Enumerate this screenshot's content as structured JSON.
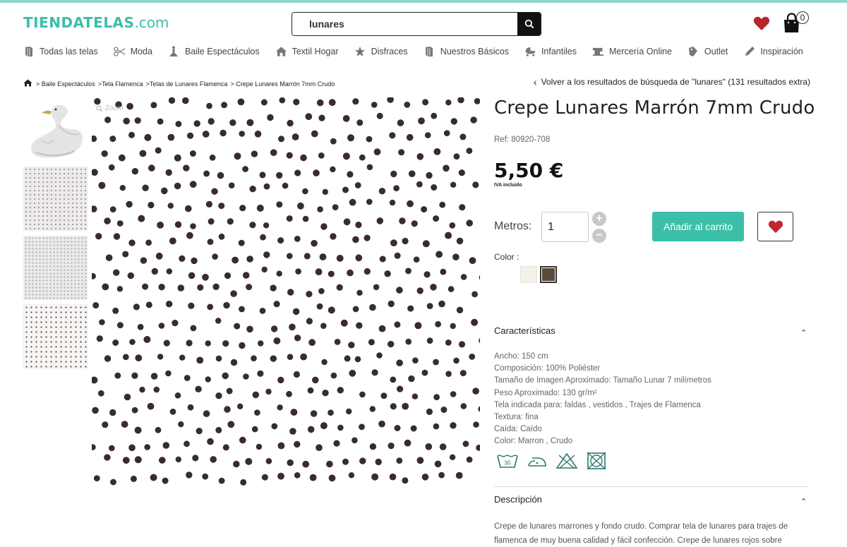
{
  "brand": {
    "logo_main": "TIENDATELAS",
    "logo_suffix": ".com",
    "accent": "#3cbfa8"
  },
  "search": {
    "value": "lunares",
    "button_icon": "search-icon"
  },
  "header": {
    "cart_count": "0",
    "wishlist_icon": "heart-icon",
    "cart_icon": "bag-icon"
  },
  "nav": [
    {
      "label": "Todas las telas",
      "icon": "fabric-roll-icon"
    },
    {
      "label": "Moda",
      "icon": "scissors-icon"
    },
    {
      "label": "Baile Espectáculos",
      "icon": "dancer-icon"
    },
    {
      "label": "Textil Hogar",
      "icon": "home-icon"
    },
    {
      "label": "Disfraces",
      "icon": "star-icon"
    },
    {
      "label": "Nuestros Básicos",
      "icon": "fabric-roll-icon"
    },
    {
      "label": "Infantiles",
      "icon": "baby-carriage-icon"
    },
    {
      "label": "Mercería Online",
      "icon": "sewing-machine-icon"
    },
    {
      "label": "Outlet",
      "icon": "tag-icon"
    },
    {
      "label": "Inspiración",
      "icon": "pencil-icon"
    }
  ],
  "breadcrumb": [
    "> Baile Espectáculos",
    ">Tela Flamenca",
    ">Telas de Lunares Flamenca",
    "> Crepe Lunares Marrón 7mm Crudo"
  ],
  "back_link": "Volver a los resultados de búsqueda de \"lunares\" (131 resultados extra)",
  "zoom_label": "Zoom",
  "product": {
    "title": "Crepe Lunares Marrón 7mm Crudo",
    "ref": "Ref: 80920-708",
    "price": "5,50 €",
    "iva": "IVA incluido",
    "metros_label": "Metros:",
    "quantity": "1",
    "plus": "+",
    "minus": "−",
    "add_to_cart": "Añadir al carrito",
    "color_label": "Color :",
    "colors": [
      "#f3f1ea",
      "#5a4a3a"
    ]
  },
  "caracteristicas": {
    "title": "Características",
    "rows": [
      "Ancho:  150 cm",
      "Composición:  100% Poliéster",
      "Tamaño de Imagen Aproximado:  Tamaño Lunar 7 milímetros",
      "Peso Aproximado:  130 gr/m²",
      "Tela indicada para:  faldas , vestidos , Trajes de Flamenca",
      "Textura:  fina",
      "Caída:  Caído",
      "Color:  Marron , Crudo"
    ],
    "care_icons": [
      "wash-30-icon",
      "iron-low-icon",
      "no-bleach-icon",
      "no-tumble-dry-icon"
    ],
    "wash_temp": "30"
  },
  "descripcion": {
    "title": "Descripción",
    "text": "Crepe de lunares marrones y fondo crudo. Comprar tela de lunares para trajes de flamenca de muy buena calidad y fácil confección. Crepe de lunares rojos sobre"
  }
}
